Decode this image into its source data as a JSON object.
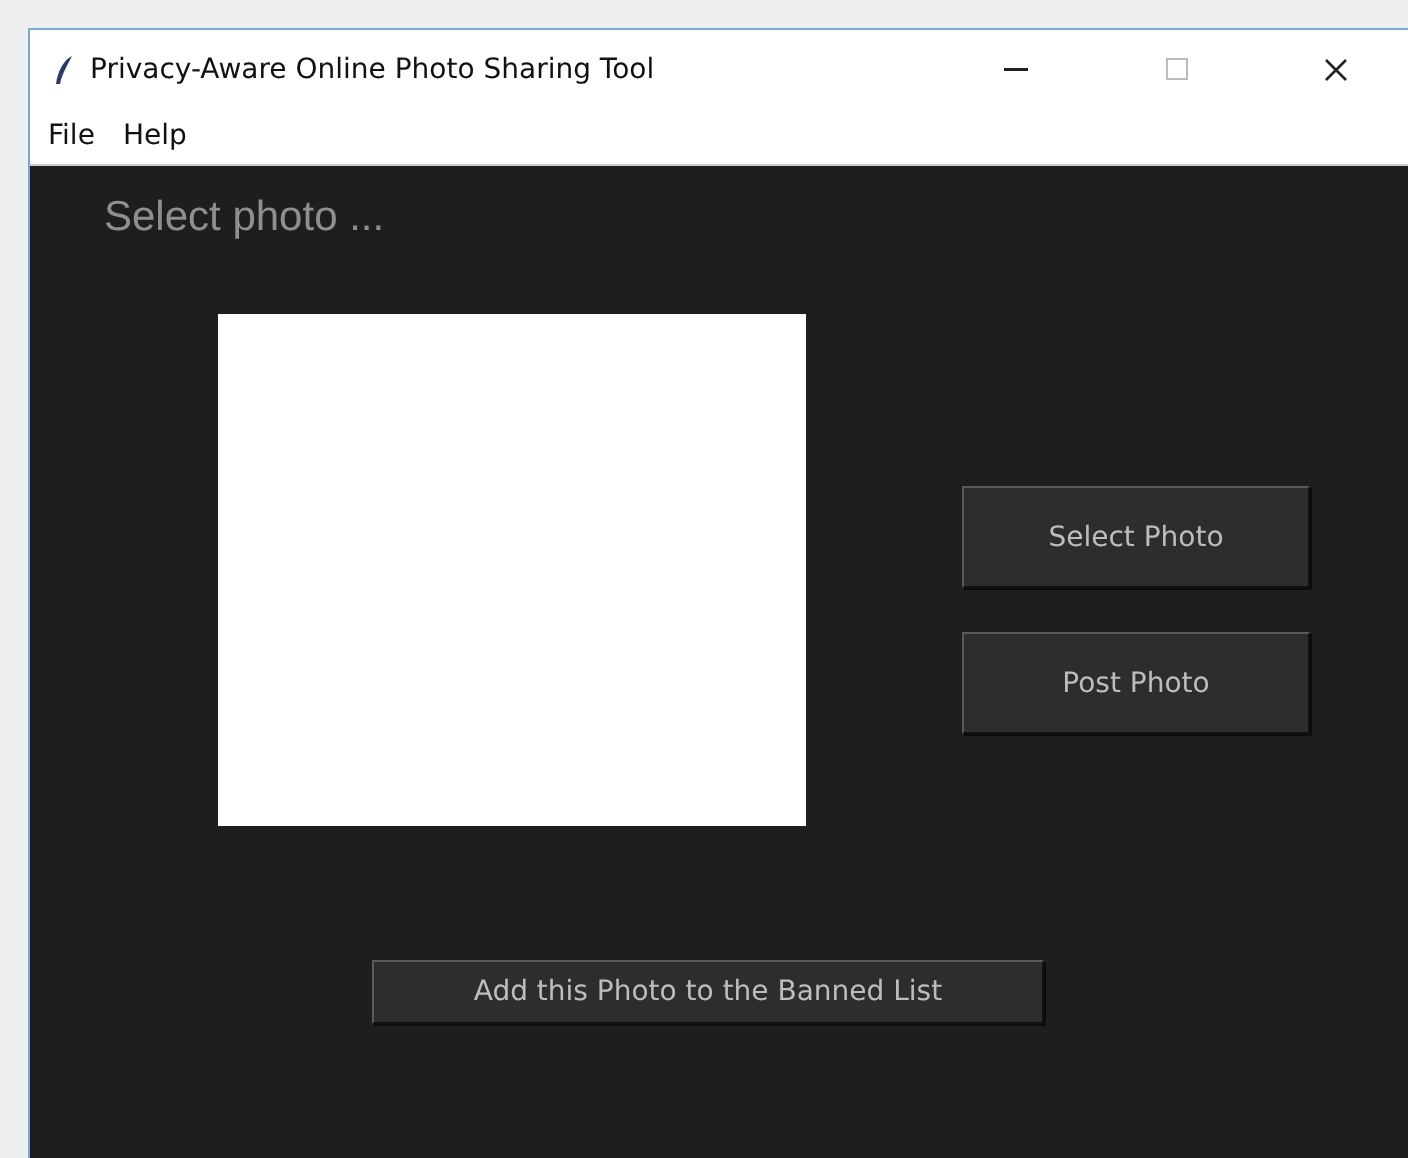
{
  "window": {
    "title": "Privacy-Aware Online Photo Sharing Tool"
  },
  "menu": [
    "File",
    "Help"
  ],
  "heading": "Select photo ...",
  "side_buttons": [
    "Select Photo",
    "Post Photo"
  ],
  "bottom_button": "Add this Photo to the Banned List"
}
